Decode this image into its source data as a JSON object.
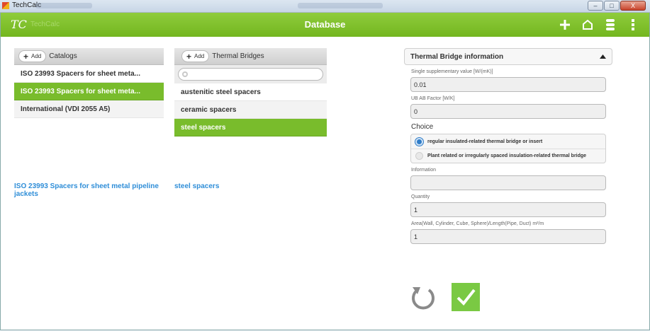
{
  "window": {
    "title": "TechCalc",
    "controls": {
      "minimize": "–",
      "maximize": "□",
      "close": "X"
    }
  },
  "appbar": {
    "logo": "TC",
    "logo_subtitle": "TechCalc",
    "title": "Database"
  },
  "catalogs": {
    "add_label": "Add",
    "title": "Catalogs",
    "items": [
      "ISO 23993 Spacers for sheet meta...",
      "ISO 23993 Spacers for sheet meta...",
      "International (VDI 2055 A5)"
    ],
    "selected_index": 1,
    "selected_full_name": "ISO 23993 Spacers for sheet metal pipeline jackets"
  },
  "bridges": {
    "add_label": "Add",
    "title": "Thermal Bridges",
    "search_placeholder": "",
    "items": [
      "austenitic steel spacers",
      "ceramic spacers",
      "steel spacers"
    ],
    "selected_index": 2,
    "selected_name": "steel spacers"
  },
  "info": {
    "header": "Thermal Bridge information",
    "fields": {
      "single_value": {
        "label": "Single supplementary value [W/(mK)]",
        "value": "0.01"
      },
      "ub_factor": {
        "label": "UB AB Factor [W/K]",
        "value": "0"
      },
      "information": {
        "label": "Information",
        "value": ""
      },
      "quantity": {
        "label": "Quantity",
        "value": "1"
      },
      "area": {
        "label": "Area(Wall, Cylinder, Cube, Sphere)/Length(Pipe, Duct) m²/m",
        "value": "1"
      }
    },
    "choice_label": "Choice",
    "choices": [
      "regular insulated-related thermal bridge or insert",
      "Plant related or irregularly spaced insulation-related thermal bridge"
    ],
    "selected_choice": 0
  },
  "colors": {
    "accent": "#79bc2c",
    "link": "#2f8ed8",
    "radio": "#2f7dc8"
  }
}
